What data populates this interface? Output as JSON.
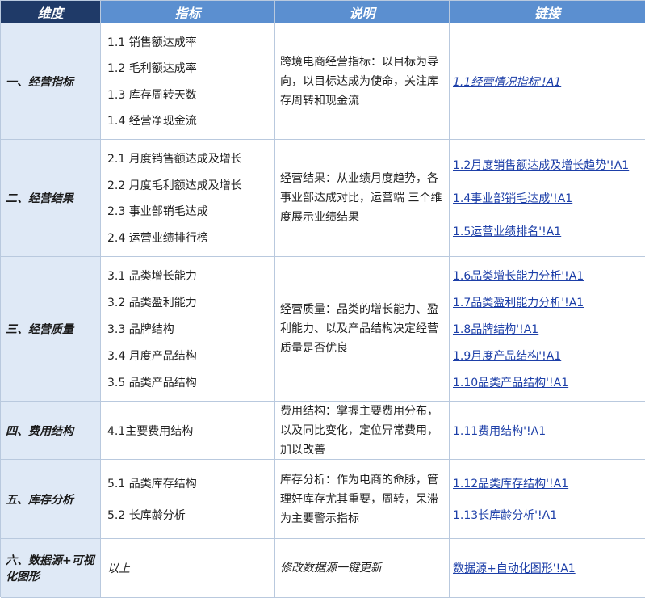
{
  "headers": [
    "维度",
    "指标",
    "说明",
    "链接"
  ],
  "rows": [
    {
      "dimension": "一、经营指标",
      "metrics": [
        "1.1 销售额达成率",
        "1.2 毛利额达成率",
        "1.3 库存周转天数",
        "1.4 经营净现金流"
      ],
      "description": "跨境电商经营指标：以目标为导向，以目标达成为使命，关注库存周转和现金流",
      "links": [
        "1.1经营情况指标'!A1"
      ]
    },
    {
      "dimension": "二、经营结果",
      "metrics": [
        "2.1 月度销售额达成及增长",
        "2.2 月度毛利额达成及增长",
        "2.3 事业部销毛达成",
        "2.4 运营业绩排行榜"
      ],
      "description": "经营结果：从业绩月度趋势，各事业部达成对比，运营端 三个维度展示业绩结果",
      "links": [
        "1.2月度销售额达成及增长趋势'!A1",
        "1.4事业部销毛达成'!A1",
        "1.5运营业绩排名'!A1"
      ]
    },
    {
      "dimension": "三、经营质量",
      "metrics": [
        "3.1 品类增长能力",
        "3.2 品类盈利能力",
        "3.3 品牌结构",
        "3.4 月度产品结构",
        "3.5 品类产品结构"
      ],
      "description": "经营质量：品类的增长能力、盈利能力、以及产品结构决定经营质量是否优良",
      "links": [
        "1.6品类增长能力分析'!A1",
        "1.7品类盈利能力分析'!A1",
        "1.8品牌结构'!A1",
        "1.9月度产品结构'!A1",
        "1.10品类产品结构'!A1"
      ]
    },
    {
      "dimension": "四、费用结构",
      "metrics": [
        "4.1主要费用结构"
      ],
      "description": "费用结构：掌握主要费用分布，以及同比变化，定位异常费用，加以改善",
      "links": [
        "1.11费用结构'!A1"
      ]
    },
    {
      "dimension": "五、库存分析",
      "metrics": [
        "5.1 品类库存结构",
        "5.2 长库龄分析"
      ],
      "description": "库存分析：作为电商的命脉，管理好库存尤其重要，周转，呆滞为主要警示指标",
      "links": [
        "1.12品类库存结构'!A1",
        "1.13长库龄分析'!A1"
      ]
    },
    {
      "dimension": "六、数据源+可视化图形",
      "metrics": [
        "以上"
      ],
      "description": "修改数据源一键更新",
      "links": [
        "数据源+自动化图形'!A1"
      ]
    }
  ]
}
